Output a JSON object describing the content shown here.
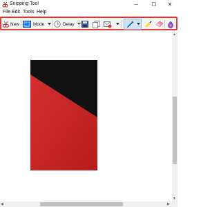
{
  "window": {
    "title": "Snipping Tool",
    "controls": {
      "minimize": "—",
      "maximize": "☐",
      "close": "✕"
    }
  },
  "menu": {
    "items": [
      "File",
      "Edit",
      "Tools",
      "Help"
    ]
  },
  "toolbar": {
    "new_label": "New",
    "mode_label": "Mode",
    "delay_label": "Delay"
  },
  "colors": {
    "highlight_border": "#e53935",
    "snip_dark": "#111111",
    "snip_red": "#cc2a22",
    "pen_active": "#cfe3f7"
  }
}
